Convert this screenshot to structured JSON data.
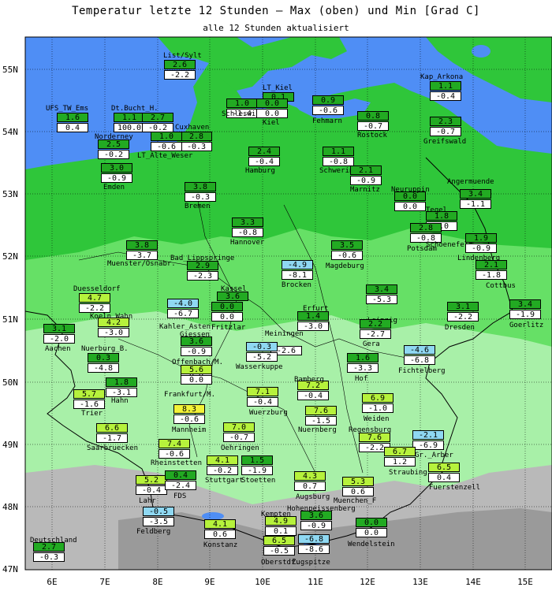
{
  "title": "Temperatur letzte 12 Stunden — Max (oben) und Min [Grad C]",
  "subtitle": "alle 12 Stunden aktualisiert",
  "axes": {
    "lon": [
      "6E",
      "7E",
      "8E",
      "9E",
      "10E",
      "11E",
      "12E",
      "13E",
      "14E",
      "15E"
    ],
    "lat": [
      "55N",
      "54N",
      "53N",
      "52N",
      "51N",
      "50N",
      "49N",
      "48N",
      "47N"
    ]
  },
  "colors": {
    "sea": "#4f8ef5",
    "land_dark": "#2fc63a",
    "land_mid": "#66e066",
    "land_light": "#a8f0a8",
    "mountain_grey": "#b9b9b9",
    "max_warm": "#b6f23c",
    "max_hot": "#f2f238",
    "max_cold": "#8fd8f2",
    "max_normal": "#22aa22"
  },
  "stations": [
    {
      "name": "List/Sylt",
      "max": "2.6",
      "min": "-2.2"
    },
    {
      "name": "LT_Kiel",
      "max": "0.1",
      "min": ""
    },
    {
      "name": "Schleswig",
      "max": "1.0",
      "min": "-1.4"
    },
    {
      "name": "Kiel",
      "max": "0.0",
      "min": "0.0"
    },
    {
      "name": "Kap_Arkona",
      "max": "1.1",
      "min": "-0.4"
    },
    {
      "name": "UFS_TW_Ems",
      "max": "1.6",
      "min": "0.4"
    },
    {
      "name": "Dt.Bucht_H.",
      "max": "1.1",
      "min": "100.0"
    },
    {
      "name": "Helgoland",
      "max": "2.7",
      "min": "-0.2"
    },
    {
      "name": "Fehmarn",
      "max": "0.9",
      "min": "-0.6"
    },
    {
      "name": "Rostock",
      "max": "0.8",
      "min": "-0.7"
    },
    {
      "name": "Greifswald",
      "max": "2.3",
      "min": "-0.7"
    },
    {
      "name": "Cuxhaven",
      "max": "2.8",
      "min": "-0.3"
    },
    {
      "name": "Norderney",
      "max": "2.5",
      "min": "-0.2"
    },
    {
      "name": "LT_Alte_Weser",
      "max": "1.0",
      "min": "-0.6"
    },
    {
      "name": "Hamburg",
      "max": "2.4",
      "min": "-0.4"
    },
    {
      "name": "Schwerin",
      "max": "1.1",
      "min": "-0.8"
    },
    {
      "name": "Marnitz",
      "max": "2.1",
      "min": "-0.9"
    },
    {
      "name": "Emden",
      "max": "3.0",
      "min": "-0.9"
    },
    {
      "name": "Neuruppin",
      "max": "0.0",
      "min": "0.0"
    },
    {
      "name": "Angermuende",
      "max": "3.4",
      "min": "-1.1"
    },
    {
      "name": "Bremen",
      "max": "3.8",
      "min": "-0.3"
    },
    {
      "name": "Tegel",
      "max": "1.8",
      "min": "0.0"
    },
    {
      "name": "Potsdam",
      "max": "2.8",
      "min": "-0.8"
    },
    {
      "name": "Schoenefeld",
      "max": "",
      "min": ""
    },
    {
      "name": "Hannover",
      "max": "3.3",
      "min": "-0.8"
    },
    {
      "name": "Lindenberg",
      "max": "1.9",
      "min": "-0.9"
    },
    {
      "name": "Muenster/Osnabr.",
      "max": "3.8",
      "min": "-3.7"
    },
    {
      "name": "Magdeburg",
      "max": "3.5",
      "min": "-0.6"
    },
    {
      "name": "Bad_Lippspringe",
      "max": "2.9",
      "min": "-2.3"
    },
    {
      "name": "Brocken",
      "max": "-4.9",
      "min": "-8.1"
    },
    {
      "name": "Cottbus",
      "max": "2.1",
      "min": "-1.8"
    },
    {
      "name": "Duesseldorf",
      "max": "4.7",
      "min": "-2.2"
    },
    {
      "name": "Kassel",
      "max": "3.6",
      "min": ""
    },
    {
      "name": "Leipzig",
      "max": "3.4",
      "min": "-5.3"
    },
    {
      "name": "Koeln_Wahn",
      "max": "4.2",
      "min": "-3.0"
    },
    {
      "name": "Kahler_Asten",
      "max": "-4.0",
      "min": "-6.7"
    },
    {
      "name": "Fritzlar",
      "max": "0.0",
      "min": "0.0"
    },
    {
      "name": "Erfurt",
      "max": "1.4",
      "min": "-3.0"
    },
    {
      "name": "Dresden",
      "max": "3.1",
      "min": "-2.2"
    },
    {
      "name": "Goerlitz",
      "max": "3.4",
      "min": "-1.9"
    },
    {
      "name": "Aachen",
      "max": "3.1",
      "min": "-2.0"
    },
    {
      "name": "Giessen",
      "max": "3.6",
      "min": "-0.9"
    },
    {
      "name": "Meiningen",
      "max": "",
      "min": "-2.6"
    },
    {
      "name": "Gera",
      "max": "2.2",
      "min": "-2.7"
    },
    {
      "name": "Nuerburg_B.",
      "max": "0.3",
      "min": "-4.8"
    },
    {
      "name": "Wasserkuppe",
      "max": "-0.3",
      "min": "-5.2"
    },
    {
      "name": "Offenbach/M.",
      "max": "",
      "min": "0.0"
    },
    {
      "name": "Fichtelberg",
      "max": "-4.6",
      "min": "-6.8"
    },
    {
      "name": "Hof",
      "max": "1.6",
      "min": "-3.3"
    },
    {
      "name": "Frankfurt/M.",
      "max": "5.6",
      "min": "0.0"
    },
    {
      "name": "Hahn",
      "max": "1.8",
      "min": "-3.1"
    },
    {
      "name": "Bamberg",
      "max": "7.2",
      "min": "-0.4"
    },
    {
      "name": "Trier",
      "max": "5.7",
      "min": "-1.6"
    },
    {
      "name": "Wuerzburg",
      "max": "7.1",
      "min": "-0.4"
    },
    {
      "name": "Weiden",
      "max": "6.9",
      "min": "-1.0"
    },
    {
      "name": "Mannheim",
      "max": "8.3",
      "min": "-0.6"
    },
    {
      "name": "Nuernberg",
      "max": "7.6",
      "min": "-1.5"
    },
    {
      "name": "Saarbruecken",
      "max": "6.6",
      "min": "-1.7"
    },
    {
      "name": "Oehringen",
      "max": "7.0",
      "min": "-0.7"
    },
    {
      "name": "Regensburg",
      "max": "7.6",
      "min": "-2.2"
    },
    {
      "name": "Gr._Arber",
      "max": "-2.1",
      "min": "-6.9"
    },
    {
      "name": "Rheinstetten",
      "max": "7.4",
      "min": "-0.6"
    },
    {
      "name": "Straubing",
      "max": "6.7",
      "min": "1.2"
    },
    {
      "name": "Stuttgart",
      "max": "4.1",
      "min": "-0.2"
    },
    {
      "name": "Stoetten",
      "max": "1.5",
      "min": "-1.9"
    },
    {
      "name": "Fuerstenzell",
      "max": "6.5",
      "min": "0.4"
    },
    {
      "name": "Lahr",
      "max": "5.2",
      "min": "-0.4"
    },
    {
      "name": "FDS",
      "max": "0.4",
      "min": "-2.4"
    },
    {
      "name": "Augsburg",
      "max": "4.3",
      "min": "0.7"
    },
    {
      "name": "Muenchen_F",
      "max": "5.3",
      "min": "0.6"
    },
    {
      "name": "Hohenpeissenberg",
      "max": "3.6",
      "min": "-0.9"
    },
    {
      "name": "Feldberg",
      "max": "-0.5",
      "min": "-3.5"
    },
    {
      "name": "Kempten",
      "max": "4.9",
      "min": "0.1"
    },
    {
      "name": "Konstanz",
      "max": "4.1",
      "min": "0.6"
    },
    {
      "name": "Wendelstein",
      "max": "0.0",
      "min": "0.0"
    },
    {
      "name": "Oberstdf.",
      "max": "6.5",
      "min": "-0.5"
    },
    {
      "name": "Zugspitze",
      "max": "-6.8",
      "min": "-8.6"
    },
    {
      "name": "Deutschland",
      "max": "2.7",
      "min": "-0.3"
    }
  ]
}
